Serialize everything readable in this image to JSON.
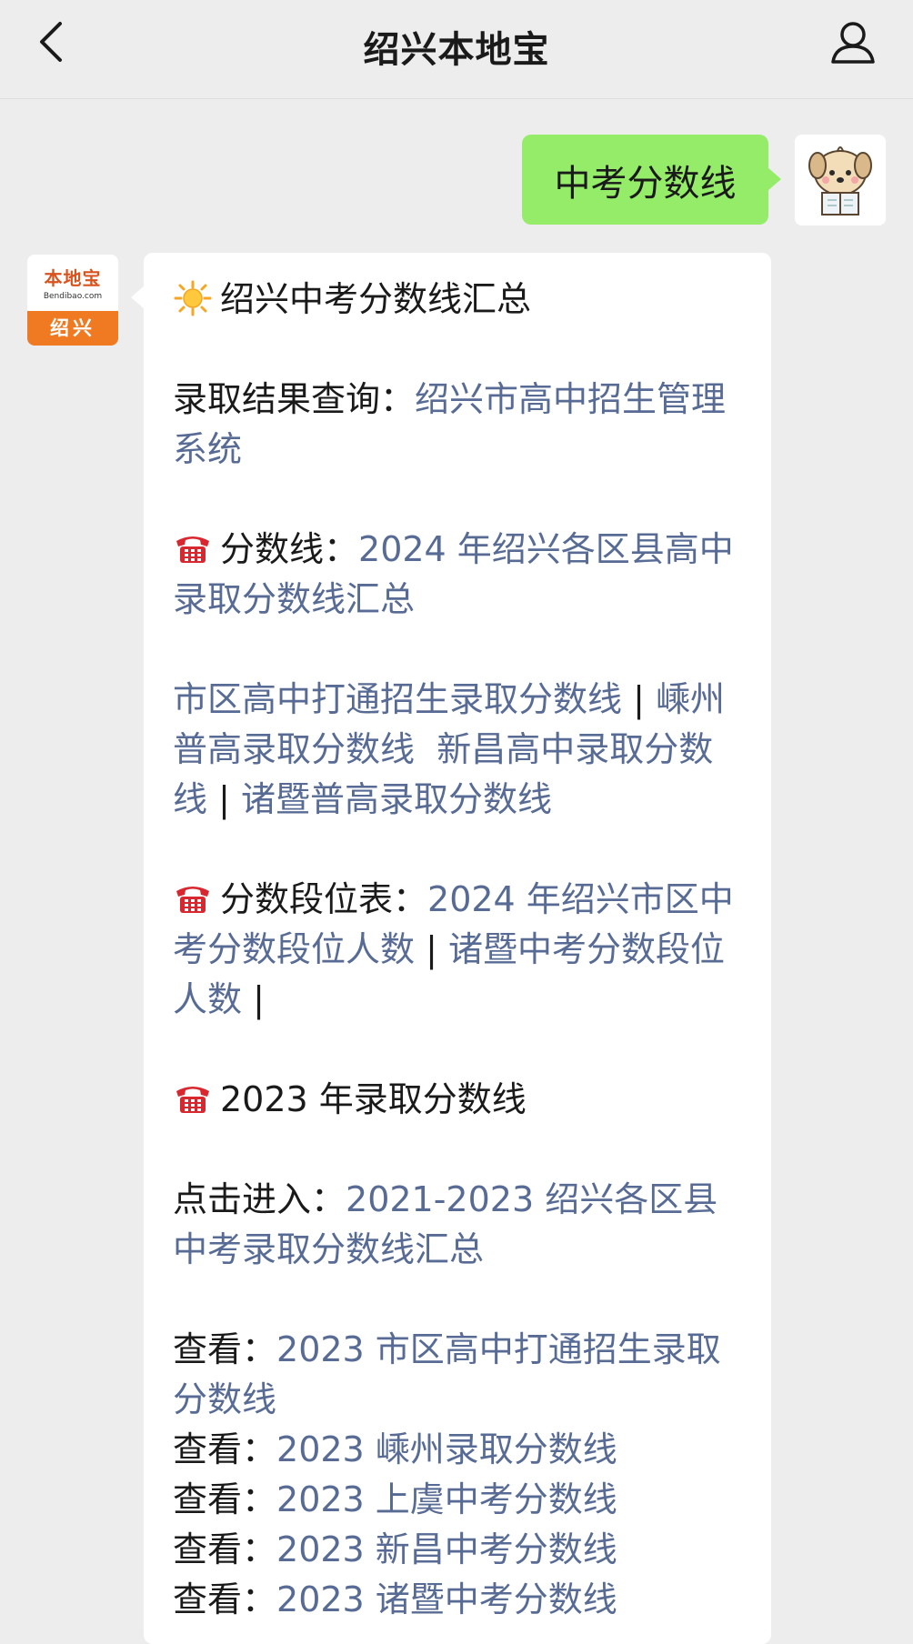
{
  "header": {
    "title": "绍兴本地宝"
  },
  "outgoing": {
    "text": "中考分数线"
  },
  "bot": {
    "logo_name": "本地宝",
    "logo_domain": "Bendibao.com",
    "logo_city": "绍兴"
  },
  "message": {
    "heading": "绍兴中考分数线汇总",
    "result_label": "录取结果查询：",
    "result_link": "绍兴市高中招生管理系统",
    "score_label": "分数线：",
    "score_link": "2024 年绍兴各区县高中录取分数线汇总",
    "links_row": {
      "l1": "市区高中打通招生录取分数线",
      "sep1": " | ",
      "l2": "嵊州普高录取分数线",
      "l3": "新昌高中录取分数线",
      "sep2": " | ",
      "l4": "诸暨普高录取分数线"
    },
    "rank_label": "分数段位表：",
    "rank_link1": "2024 年绍兴市区中考分数段位人数",
    "rank_sep": " | ",
    "rank_link2": "诸暨中考分数段位人数",
    "rank_tail": " |",
    "year2023_label": "2023 年录取分数线",
    "enter_label": "点击进入：",
    "enter_link": "2021-2023 绍兴各区县中考录取分数线汇总",
    "view_label": "查看：",
    "view_links": [
      "2023 市区高中打通招生录取分数线",
      "2023 嵊州录取分数线",
      "2023 上虞中考分数线",
      "2023 新昌中考分数线",
      "2023 诸暨中考分数线"
    ]
  },
  "icons": {
    "back": "chevron-left-icon",
    "profile": "person-icon",
    "sun": "sun-icon",
    "phone": "telephone-icon"
  },
  "colors": {
    "background": "#ededed",
    "outgoing_bubble": "#95ec69",
    "link": "#576b95",
    "logo_orange": "#f07a22",
    "phone_red": "#d8272e"
  }
}
